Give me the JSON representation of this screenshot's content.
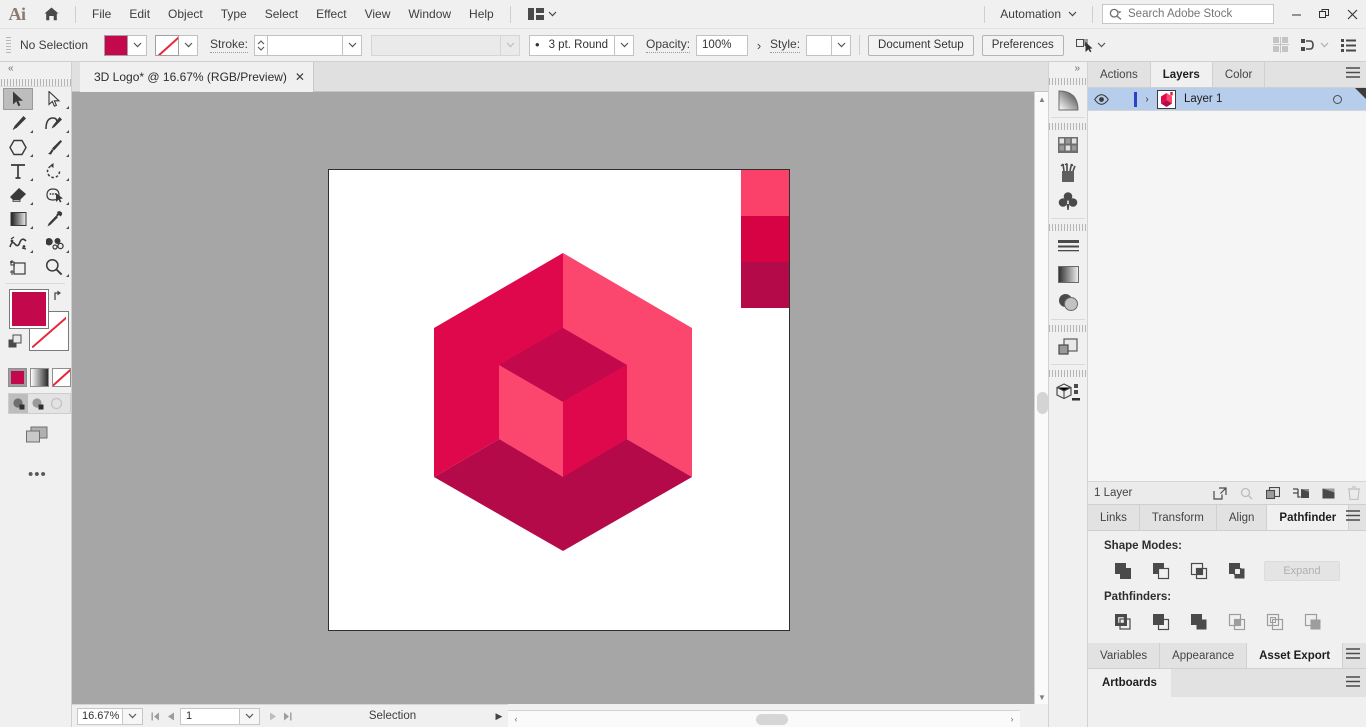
{
  "app": {
    "name": "Ai",
    "logo_icon": "adobe-illustrator-logo",
    "home_icon": "home-icon"
  },
  "menubar": {
    "items": [
      "File",
      "Edit",
      "Object",
      "Type",
      "Select",
      "Effect",
      "View",
      "Window",
      "Help"
    ],
    "arrange_icon": "arrange-documents-icon",
    "arrange_caret": "chevron-down-icon",
    "automation": {
      "label": "Automation",
      "caret": "chevron-down-icon"
    },
    "search": {
      "placeholder": "Search Adobe Stock",
      "value": "",
      "icon": "search-icon"
    },
    "window_controls": {
      "minimize": "–",
      "maximize": "❐",
      "close": "✕"
    }
  },
  "controlbar": {
    "selection_status": "No Selection",
    "fill_color": "#c3084c",
    "fill_caret": "chevron-down-icon",
    "stroke_swatch_icon": "none-swatch-icon",
    "stroke_caret": "chevron-down-icon",
    "stroke_label": "Stroke:",
    "stroke_weight_value": "",
    "stroke_weight_caret": "chevron-down-icon",
    "variable_width_value": "",
    "variable_width_caret": "chevron-down-icon",
    "brush_definition": "3 pt. Round",
    "brush_caret": "chevron-down-icon",
    "opacity_label": "Opacity:",
    "opacity_value": "100%",
    "opacity_arrow": "›",
    "style_label": "Style:",
    "style_value": "",
    "style_caret": "chevron-down-icon",
    "document_setup_label": "Document Setup",
    "preferences_label": "Preferences",
    "select_similar_icon": "select-similar-objects-icon",
    "select_similar_caret": "chevron-down-icon",
    "align_icon": "align-icon",
    "distribute_icon": "distribute-icon",
    "distribute_caret": "chevron-down-icon",
    "workspace_icon": "workspace-list-icon"
  },
  "document_tab": {
    "title": "3D Logo* @ 16.67% (RGB/Preview)",
    "close_icon": "close-icon"
  },
  "toolbar": {
    "collapse_icon": "double-chevron-left-icon",
    "tools": [
      {
        "name": "selection-tool",
        "icon": "selection-arrow-icon",
        "selected": true,
        "has_flyout": false
      },
      {
        "name": "direct-selection-tool",
        "icon": "direct-selection-arrow-icon",
        "selected": false,
        "has_flyout": true
      },
      {
        "name": "pen-tool",
        "icon": "pen-icon",
        "selected": false,
        "has_flyout": true
      },
      {
        "name": "curvature-tool",
        "icon": "curvature-icon",
        "selected": false,
        "has_flyout": true
      },
      {
        "name": "shape-tool",
        "icon": "polygon-icon",
        "selected": false,
        "has_flyout": true
      },
      {
        "name": "paintbrush-tool",
        "icon": "paintbrush-icon",
        "selected": false,
        "has_flyout": true
      },
      {
        "name": "type-tool",
        "icon": "type-T-icon",
        "selected": false,
        "has_flyout": true
      },
      {
        "name": "rotate-tool",
        "icon": "rotate-icon",
        "selected": false,
        "has_flyout": true
      },
      {
        "name": "eraser-tool",
        "icon": "eraser-icon",
        "selected": false,
        "has_flyout": true
      },
      {
        "name": "shape-builder-tool",
        "icon": "shape-builder-icon",
        "selected": false,
        "has_flyout": true
      },
      {
        "name": "gradient-tool",
        "icon": "gradient-icon",
        "selected": false,
        "has_flyout": true
      },
      {
        "name": "eyedropper-tool",
        "icon": "eyedropper-icon",
        "selected": false,
        "has_flyout": true
      },
      {
        "name": "width-tool",
        "icon": "warp-icon",
        "selected": false,
        "has_flyout": true
      },
      {
        "name": "symbol-sprayer-tool",
        "icon": "symbol-sprayer-icon",
        "selected": false,
        "has_flyout": true
      },
      {
        "name": "artboard-tool",
        "icon": "artboard-icon",
        "selected": false,
        "has_flyout": false
      },
      {
        "name": "zoom-tool",
        "icon": "magnifier-icon",
        "selected": false,
        "has_flyout": true
      }
    ],
    "fill_color": "#c3084c",
    "stroke_color": "#ffffff",
    "stroke_is_none": true,
    "swap_icon": "swap-fill-stroke-icon",
    "default_icon": "default-fill-stroke-icon",
    "color_modes": [
      {
        "name": "color-mode-color",
        "selected": true
      },
      {
        "name": "color-mode-gradient",
        "selected": false
      },
      {
        "name": "color-mode-none",
        "selected": false
      }
    ],
    "draw_modes": [
      {
        "name": "draw-normal-mode",
        "selected": true
      },
      {
        "name": "draw-behind-mode",
        "selected": false
      },
      {
        "name": "draw-inside-mode",
        "selected": false
      }
    ],
    "screen_mode_icon": "change-screen-mode-icon",
    "more_tools_icon": "edit-toolbar-ellipsis-icon"
  },
  "canvas": {
    "background_color": "#a6a6a6",
    "artboard_color": "#ffffff",
    "artwork_name": "3d-hexagon-cube-logo",
    "logo_colors": {
      "left_face": "#e0084c",
      "right_face": "#fb466d",
      "bottom_face": "#b50a4a",
      "inner_top": "#c3084c",
      "inner_left": "#fb466d",
      "inner_right": "#e0084c"
    },
    "swatch_strip": [
      {
        "name": "swatch-pink",
        "color": "#fb4169"
      },
      {
        "name": "swatch-crimson",
        "color": "#d60243"
      },
      {
        "name": "swatch-dark-crimson",
        "color": "#b50a4a"
      }
    ],
    "vscroll_up_icon": "chevron-up-icon",
    "vscroll_down_icon": "chevron-down-icon",
    "hscroll_left_icon": "chevron-left-icon",
    "hscroll_right_icon": "chevron-right-icon"
  },
  "statusbar": {
    "zoom_level": "16.67%",
    "zoom_caret": "chevron-down-icon",
    "first_icon": "first-artboard-icon",
    "prev_icon": "previous-artboard-icon",
    "artboard_number": "1",
    "artboard_caret": "chevron-down-icon",
    "next_icon": "next-artboard-icon",
    "last_icon": "last-artboard-icon",
    "status_text": "Selection",
    "status_menu_icon": "play-triangle-icon"
  },
  "dockstrip": {
    "collapse_icon": "double-chevron-right-icon",
    "groups": [
      [
        {
          "name": "gradient-panel-icon"
        }
      ],
      [
        {
          "name": "swatches-panel-icon"
        },
        {
          "name": "brushes-panel-icon"
        },
        {
          "name": "symbols-panel-icon"
        }
      ],
      [
        {
          "name": "stroke-panel-icon"
        },
        {
          "name": "gradient-panel-icon-2"
        },
        {
          "name": "transparency-panel-icon"
        }
      ],
      [
        {
          "name": "pathfinder-panel-icon"
        }
      ],
      [
        {
          "name": "3d-and-materials-panel-icon"
        }
      ]
    ]
  },
  "panels": {
    "group_layers": {
      "tabs": [
        {
          "label": "Actions",
          "active": false
        },
        {
          "label": "Layers",
          "active": true
        },
        {
          "label": "Color",
          "active": false
        }
      ],
      "menu_icon": "panel-menu-icon",
      "layer": {
        "visibility_icon": "eye-icon",
        "lock_icon": "lock-placeholder-icon",
        "color_bar": "#2a44c4",
        "expand_icon": "chevron-right-icon",
        "thumbnail_icon": "layer-thumbnail",
        "name": "Layer 1",
        "target_icon": "target-circle-icon",
        "selected": true
      },
      "footer": {
        "count_label": "1 Layer",
        "icons": [
          "locate-object-icon",
          "release-to-layers-icon",
          "collect-in-new-layer-icon",
          "create-new-sublayer-icon",
          "create-new-layer-icon",
          "delete-selection-icon"
        ]
      }
    },
    "group_pathfinder": {
      "tabs": [
        {
          "label": "Links",
          "active": false
        },
        {
          "label": "Transform",
          "active": false
        },
        {
          "label": "Align",
          "active": false
        },
        {
          "label": "Pathfinder",
          "active": true
        }
      ],
      "menu_icon": "panel-menu-icon",
      "shape_modes_label": "Shape Modes:",
      "shape_modes": [
        "unite-icon",
        "minus-front-icon",
        "intersect-icon",
        "exclude-icon"
      ],
      "expand_label": "Expand",
      "expand_enabled": false,
      "pathfinders_label": "Pathfinders:",
      "pathfinders": [
        "divide-icon",
        "trim-icon",
        "merge-icon",
        "crop-icon",
        "outline-icon",
        "minus-back-icon"
      ]
    },
    "group_assetexport": {
      "tabs": [
        {
          "label": "Variables",
          "active": false
        },
        {
          "label": "Appearance",
          "active": false
        },
        {
          "label": "Asset Export",
          "active": true
        }
      ],
      "menu_icon": "panel-menu-icon"
    },
    "group_artboards": {
      "tabs": [
        {
          "label": "Artboards",
          "active": true
        }
      ],
      "menu_icon": "panel-menu-icon"
    }
  }
}
